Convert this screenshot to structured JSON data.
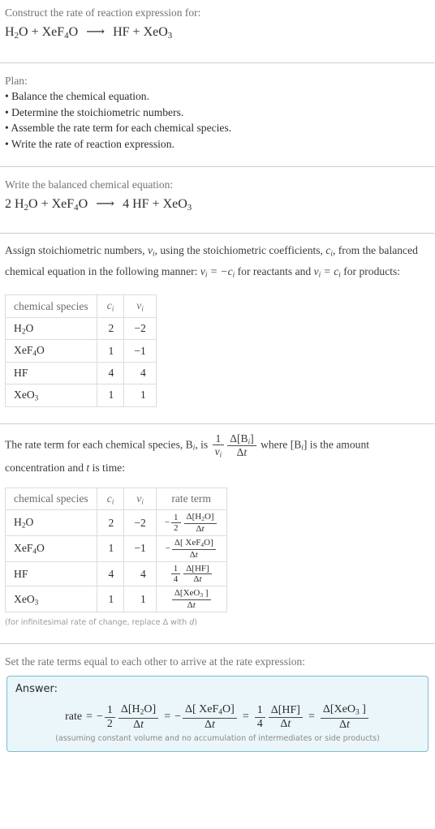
{
  "prompt": {
    "title": "Construct the rate of reaction expression for:",
    "equation_plain": "H2O + XeF4O ⟶ HF + XeO3"
  },
  "plan": {
    "heading": "Plan:",
    "steps": [
      "• Balance the chemical equation.",
      "• Determine the stoichiometric numbers.",
      "• Assemble the rate term for each chemical species.",
      "• Write the rate of reaction expression."
    ]
  },
  "balanced": {
    "heading": "Write the balanced chemical equation:",
    "equation_plain": "2 H2O + XeF4O ⟶ 4 HF + XeO3",
    "coefficients": {
      "H2O": 2,
      "XeF4O": 1,
      "HF": 4,
      "XeO3": 1
    }
  },
  "stoich": {
    "paragraph_plain": "Assign stoichiometric numbers, ν_i, using the stoichiometric coefficients, c_i, from the balanced chemical equation in the following manner: ν_i = −c_i for reactants and ν_i = c_i for products:",
    "p1": "Assign stoichiometric numbers, ",
    "p2": ", using the stoichiometric coefficients, ",
    "p3": ", from the balanced chemical equation in the following manner: ",
    "p4": " for reactants and ",
    "p5": " for products:",
    "table": {
      "headers": [
        "chemical species",
        "c",
        "ν"
      ],
      "rows": [
        {
          "species_plain": "H2O",
          "c": "2",
          "v": "−2"
        },
        {
          "species_plain": "XeF4O",
          "c": "1",
          "v": "−1"
        },
        {
          "species_plain": "HF",
          "c": "4",
          "v": "4"
        },
        {
          "species_plain": "XeO3",
          "c": "1",
          "v": "1"
        }
      ]
    }
  },
  "rate_term": {
    "p1": "The rate term for each chemical species, ",
    "p2": ", is ",
    "p3": " where ",
    "p4": " is the amount",
    "p5": "concentration and ",
    "p6": " is time:",
    "paragraph_plain": "The rate term for each chemical species, B_i, is (1/ν_i)(Δ[B_i]/Δt) where [B_i] is the amount concentration and t is time:",
    "table": {
      "headers": [
        "chemical species",
        "c",
        "ν",
        "rate term"
      ],
      "rows": [
        {
          "species_plain": "H2O",
          "c": "2",
          "v": "−2",
          "rate_plain": "−(1/2) Δ[H2O]/Δt",
          "sign": "−",
          "coef_num": "1",
          "coef_den": "2",
          "has_coef": true
        },
        {
          "species_plain": "XeF4O",
          "c": "1",
          "v": "−1",
          "rate_plain": "− Δ[XeF4O]/Δt",
          "sign": "−",
          "coef_num": "",
          "coef_den": "",
          "has_coef": false
        },
        {
          "species_plain": "HF",
          "c": "4",
          "v": "4",
          "rate_plain": "(1/4) Δ[HF]/Δt",
          "sign": "",
          "coef_num": "1",
          "coef_den": "4",
          "has_coef": true
        },
        {
          "species_plain": "XeO3",
          "c": "1",
          "v": "1",
          "rate_plain": "Δ[XeO3]/Δt",
          "sign": "",
          "coef_num": "",
          "coef_den": "",
          "has_coef": false
        }
      ]
    },
    "footnote_p1": "(for infinitesimal rate of change, replace Δ with ",
    "footnote_p2": ")",
    "footnote_plain": "(for infinitesimal rate of change, replace Δ with d)"
  },
  "final": {
    "heading": "Set the rate terms equal to each other to arrive at the rate expression:",
    "answer_label": "Answer:",
    "rate_word": "rate",
    "expression_plain": "rate = −(1/2) Δ[H2O]/Δt = − Δ[XeF4O]/Δt = (1/4) Δ[HF]/Δt = Δ[XeO3]/Δt",
    "assumption": "(assuming constant volume and no accumulation of intermediates or side products)"
  },
  "symbols": {
    "delta": "Δ",
    "nu": "ν",
    "minus": "−",
    "arrow": "⟶",
    "equals": "=",
    "t": "t",
    "d": "d",
    "B": "B",
    "i": "i",
    "c": "c",
    "one": "1",
    "two": "2",
    "four": "4"
  },
  "colors": {
    "page_bg": "#ffffff",
    "body_text": "#3c3c3c",
    "label_text": "#737373",
    "rule": "#cfcfcf",
    "table_border": "#dcdcdc",
    "answer_bg": "#eaf6fa",
    "answer_border": "#7fbdcb",
    "muted_note": "#9a9a9a"
  }
}
